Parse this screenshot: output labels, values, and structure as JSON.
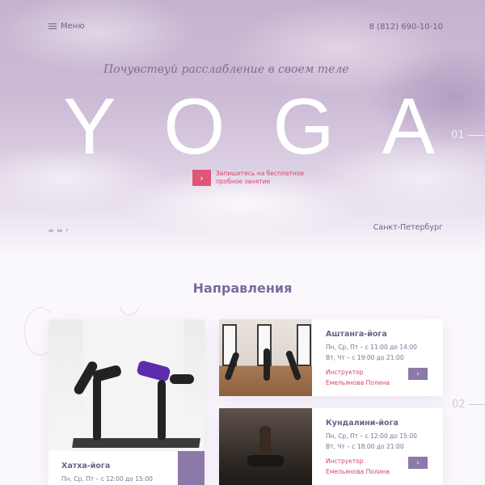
{
  "header": {
    "menu_label": "Меню",
    "phone": "8 (812) 690-10-10"
  },
  "hero": {
    "tagline": "Почувствуй расслабление в своем теле",
    "title_letters": [
      "Y",
      "O",
      "G",
      "A"
    ],
    "slide_number": "01",
    "cta_text": "Запишитесь на бесплатное пробное занятие",
    "cta_icon": "chevron-right-icon",
    "social": [
      "vk",
      "tw",
      "f"
    ],
    "city": "Санкт-Петербург"
  },
  "section": {
    "title": "Направления",
    "slide_number": "02"
  },
  "cards": [
    {
      "title": "Хатха-йога",
      "schedule1": "Пн, Ср, Пт – с 12:00 до 15:00"
    },
    {
      "title": "Аштанга-йога",
      "schedule1": "Пн, Ср, Пт – с 11:00 до 14:00",
      "schedule2": "Вт, Чт – с 19:00 до 21:00",
      "instructor_label": "Инструктор",
      "instructor": "Емельянова Полина",
      "arrow": "›"
    },
    {
      "title": "Кундалини-йога",
      "schedule1": "Пн, Ср, Пт – с 12:00 до 15:00",
      "schedule2": "Вт, Чт – с 18:00 до 21:00",
      "instructor_label": "Инструктор",
      "instructor": "Емельянова Полина",
      "arrow": "›"
    }
  ],
  "colors": {
    "accent": "#e05578",
    "brand": "#8c79a8",
    "text": "#6e6088"
  }
}
